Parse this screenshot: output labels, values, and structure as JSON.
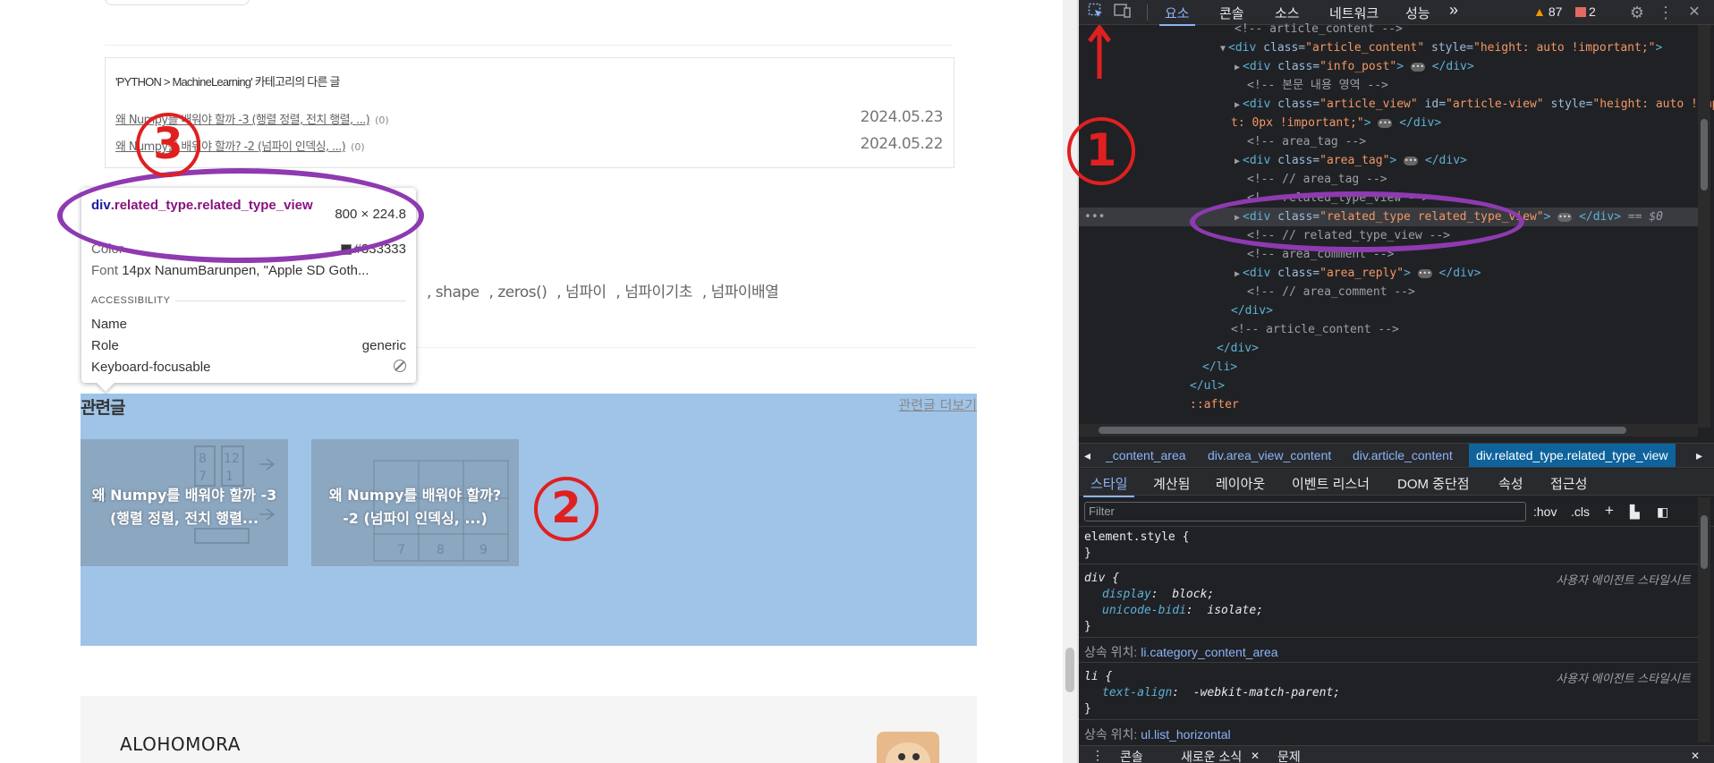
{
  "page": {
    "category_header": "'PYTHON > MachineLearning' 카테고리의 다른 글",
    "category_posts": [
      {
        "title": "왜 Numpy를 배워야 할까 -3 (행렬 정렬, 전치 행렬, ...)",
        "count": "(0)",
        "date": "2024.05.23"
      },
      {
        "title": "왜 Numpy를 배워야 할까? -2 (넘파이 인덱싱, ...)",
        "count": "(0)",
        "date": "2024.05.22"
      }
    ],
    "tags": [
      ", shape",
      ", zeros()",
      ", 넘파이",
      ", 넘파이기초",
      ", 넘파이배열"
    ],
    "related_title": "관련글",
    "related_more": "관련글 더보기",
    "related_cards": [
      {
        "label": "왜 Numpy를 배워야 할까 -3 (행렬 정렬, 전치 행렬..."
      },
      {
        "label": "왜 Numpy를 배워야 할까? -2 (넘파이 인덱싱, ...)"
      }
    ],
    "footer_name": "ALOHOMORA"
  },
  "tooltip": {
    "selector_tag": "div",
    "selector_classes": ".related_type.related_type_view",
    "dimensions": "800 × 224.8",
    "color_label": "Color",
    "color_value": "#333333",
    "font_label": "Font",
    "font_value": "14px NanumBarunpen, \"Apple SD Goth...",
    "section": "ACCESSIBILITY",
    "name_label": "Name",
    "role_label": "Role",
    "role_value": "generic",
    "focus_label": "Keyboard-focusable"
  },
  "annotations": {
    "n1": "1",
    "n2": "2",
    "n3": "3"
  },
  "devtools": {
    "tabs": [
      "요소",
      "콘솔",
      "소스",
      "네트워크",
      "성능"
    ],
    "more": "»",
    "warnings": "87",
    "errors": "2",
    "elements": [
      {
        "indent": 0,
        "text": "<!-- article_content -->",
        "kind": "comment"
      },
      {
        "indent": 1,
        "text": "<div class=\"article_content\" style=\"height: auto !important;\">",
        "kind": "open"
      },
      {
        "indent": 2,
        "text": "<div class=\"info_post\">",
        "kind": "collapsed",
        "close": "</div>"
      },
      {
        "indent": 2,
        "text": "<!-- 본문 내용 영역 -->",
        "kind": "comment"
      },
      {
        "indent": 2,
        "text": "<div class=\"article_view\" id=\"article-view\" style=\"height: auto !important; m",
        "kind": "collapsed_wrap"
      },
      {
        "indent": 3,
        "text": "t: 0px !important;\">",
        "kind": "wrap_tail",
        "close": "</div>"
      },
      {
        "indent": 2,
        "text": "<!-- area_tag -->",
        "kind": "comment"
      },
      {
        "indent": 2,
        "text": "<div class=\"area_tag\">",
        "kind": "collapsed",
        "close": "</div>"
      },
      {
        "indent": 2,
        "text": "<!-- // area_tag -->",
        "kind": "comment"
      },
      {
        "indent": 2,
        "text": "<!-- related_type_view -->",
        "kind": "comment"
      },
      {
        "indent": 2,
        "text": "<div class=\"related_type related_type_view\">",
        "kind": "selected",
        "close": "</div>",
        "suffix": "== $0"
      },
      {
        "indent": 2,
        "text": "<!-- // related_type_view -->",
        "kind": "comment"
      },
      {
        "indent": 2,
        "text": "<!-- area_comment -->",
        "kind": "comment"
      },
      {
        "indent": 2,
        "text": "<div class=\"area_reply\">",
        "kind": "collapsed",
        "close": "</div>"
      },
      {
        "indent": 2,
        "text": "<!-- // area_comment -->",
        "kind": "comment"
      },
      {
        "indent": 1,
        "text": "</div>",
        "kind": "tag"
      },
      {
        "indent": 1,
        "text": "<!-- article_content -->",
        "kind": "comment"
      },
      {
        "indent": 0,
        "text": "</div>",
        "kind": "tag"
      },
      {
        "indent": -1,
        "text": "</li>",
        "kind": "tag"
      },
      {
        "indent": -2,
        "text": "</ul>",
        "kind": "tag"
      },
      {
        "indent": -2,
        "text": "::after",
        "kind": "pseudo"
      }
    ],
    "breadcrumbs": [
      "_content_area",
      "div.area_view_content",
      "div.article_content",
      "div.related_type.related_type_view"
    ],
    "sub_tabs": [
      "스타일",
      "계산됨",
      "레이아웃",
      "이벤트 리스너",
      "DOM 중단점",
      "속성",
      "접근성"
    ],
    "filter_placeholder": "Filter",
    "hov": ":hov",
    "cls": ".cls",
    "styles": {
      "element_style": "element.style {",
      "close": "}",
      "div_sel": "div {",
      "ua_source": "사용자 에이전트 스타일시트",
      "display_prop": "display",
      "display_val": "block;",
      "bidi_prop": "unicode-bidi",
      "bidi_val": "isolate;",
      "inherited_label": "상속 위치:",
      "inherited_1": "li.category_content_area",
      "li_sel": "li {",
      "text_align_prop": "text-align",
      "text_align_val": "-webkit-match-parent;",
      "inherited_2": "ul.list_horizontal"
    },
    "drawer": [
      "콘솔",
      "새로운 소식",
      "문제"
    ]
  },
  "colors": {
    "highlight": "#9fc4e8",
    "annotation_red": "#e02020",
    "annotation_purple": "#8e3ab0",
    "devtools_bg": "#202124"
  }
}
